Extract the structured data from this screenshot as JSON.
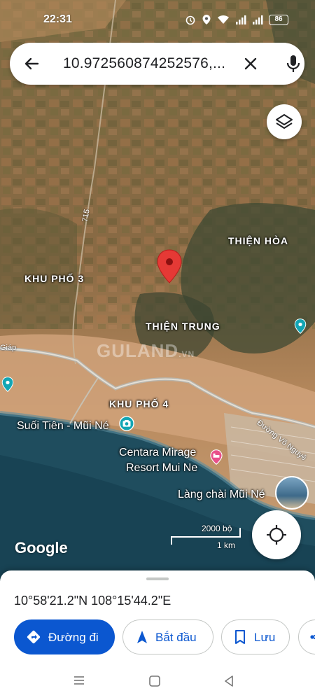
{
  "status_bar": {
    "time": "22:31",
    "battery": "86",
    "icons": [
      "alarm-icon",
      "location-icon",
      "wifi-icon",
      "signal-icon",
      "signal-icon",
      "battery-icon"
    ]
  },
  "search": {
    "query": "10.972560874252576,...",
    "icons": {
      "back": "back-arrow-icon",
      "clear": "close-icon",
      "voice": "mic-icon"
    }
  },
  "map": {
    "type": "satellite",
    "labels": {
      "thien_hoa": "THIỆN HÒA",
      "khu_pho_3": "KHU PHỐ 3",
      "thien_trung": "THIỆN TRUNG",
      "khu_pho_4": "KHU PHỐ 4"
    },
    "roads": {
      "route_715": "715",
      "giap": "Giáp",
      "vo_nguyen": "Đường Võ Nguyê"
    },
    "pois": {
      "suoi_tien": "Suối Tiên - Mũi Né",
      "centara_line1": "Centara Mirage",
      "centara_line2": "Resort Mui Ne",
      "lang_chai": "Làng chài Mũi Né"
    },
    "watermark": "GULAND",
    "watermark_suffix": ".VN",
    "attribution": "Google",
    "scale": {
      "imperial": "2000 bộ",
      "metric": "1 km"
    },
    "colors": {
      "pin": "#e53935",
      "poi_teal": "#12a5b4",
      "poi_pink": "#e8508a",
      "water": "#1f4d5e"
    }
  },
  "sheet": {
    "coordinates": "10°58'21.2\"N 108°15'44.2\"E",
    "actions": [
      {
        "label": "Đường đi",
        "icon": "directions-icon"
      },
      {
        "label": "Bắt đầu",
        "icon": "navigation-arrow-icon"
      },
      {
        "label": "Lưu",
        "icon": "bookmark-icon"
      },
      {
        "label": "",
        "icon": "share-icon"
      }
    ],
    "accent": "#0b57d0"
  },
  "nav_bar": {
    "icons": [
      "menu-icon",
      "home-icon",
      "back-icon"
    ]
  }
}
